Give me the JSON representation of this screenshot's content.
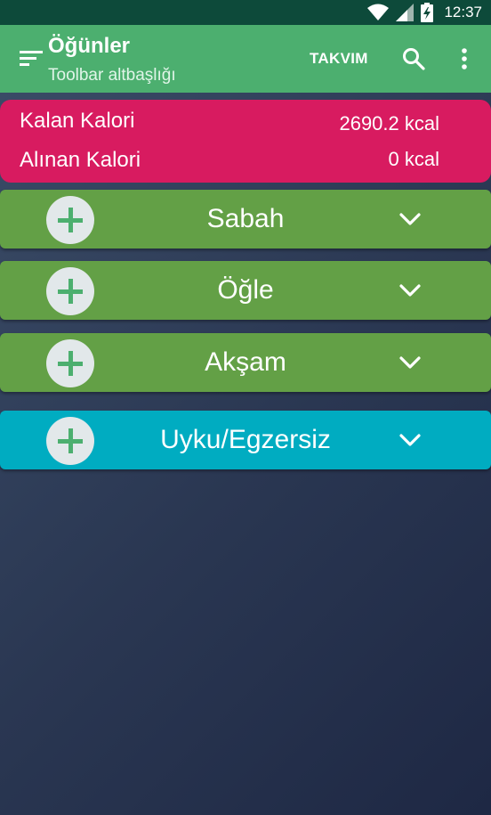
{
  "status_bar": {
    "time": "12:37",
    "icons": [
      "wifi-icon",
      "signal-icon",
      "battery-charging-icon"
    ]
  },
  "toolbar": {
    "title": "Öğünler",
    "subtitle": "Toolbar altbaşlığı",
    "action_label": "TAKVIM",
    "icons": [
      "sort-menu-icon",
      "search-icon",
      "more-vert-icon"
    ]
  },
  "calories": {
    "remaining_label": "Kalan Kalori",
    "remaining_value": "2690.2 kcal",
    "taken_label": "Alınan Kalori",
    "taken_value": "0 kcal"
  },
  "meals": [
    {
      "label": "Sabah"
    },
    {
      "label": "Öğle"
    },
    {
      "label": "Akşam"
    },
    {
      "label": "Uyku/Egzersiz"
    }
  ],
  "colors": {
    "status_bar": "#0d4a3a",
    "toolbar": "#4caf6f",
    "calorie_card": "#d81b60",
    "meal_row": "#63a046",
    "sleep_row": "#00acc1",
    "add_button": "#e2e8ea",
    "plus_icon": "#4caf6f"
  }
}
